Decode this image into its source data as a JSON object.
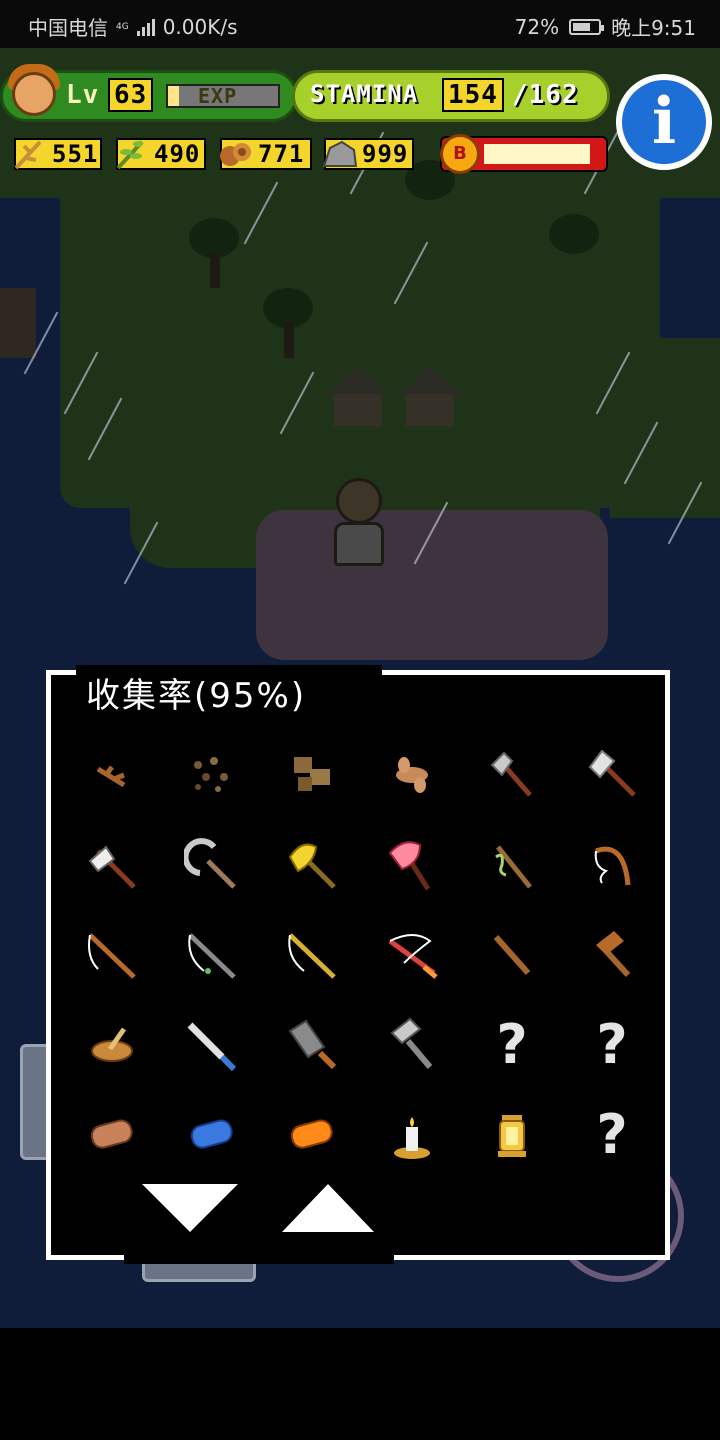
{
  "status_bar": {
    "carrier": "中国电信",
    "network": "4G",
    "speed": "0.00K/s",
    "battery": "72%",
    "battery_level": 0.72,
    "time": "晚上9:51"
  },
  "hud": {
    "level_label": "Lv",
    "level": "63",
    "exp_label": "EXP",
    "exp_fraction": 0.1,
    "stamina_label": "STAMINA",
    "stamina_current": "154",
    "stamina_max": "/162",
    "bonus_label": "B",
    "bonus_fraction": 0.95
  },
  "resources": [
    {
      "name": "branch",
      "value": "551"
    },
    {
      "name": "leaf",
      "value": "490"
    },
    {
      "name": "wood",
      "value": "771"
    },
    {
      "name": "stone",
      "value": "999"
    }
  ],
  "collection": {
    "title": "收集率(95%)",
    "items": [
      {
        "icon": "twig-icon",
        "unknown": false
      },
      {
        "icon": "pebbles-icon",
        "unknown": false
      },
      {
        "icon": "rocks-icon",
        "unknown": false
      },
      {
        "icon": "ginger-root-icon",
        "unknown": false
      },
      {
        "icon": "stone-axe-icon",
        "unknown": false
      },
      {
        "icon": "iron-axe-icon",
        "unknown": false
      },
      {
        "icon": "hand-axe-icon",
        "unknown": false
      },
      {
        "icon": "sickle-icon",
        "unknown": false
      },
      {
        "icon": "gold-battle-axe-icon",
        "unknown": false
      },
      {
        "icon": "red-battle-axe-icon",
        "unknown": false
      },
      {
        "icon": "vine-staff-icon",
        "unknown": false
      },
      {
        "icon": "wooden-bow-icon",
        "unknown": false
      },
      {
        "icon": "fishing-rod-icon",
        "unknown": false
      },
      {
        "icon": "fishing-rod-green-icon",
        "unknown": false
      },
      {
        "icon": "fishing-rod-gold-icon",
        "unknown": false
      },
      {
        "icon": "fishing-rod-red-icon",
        "unknown": false
      },
      {
        "icon": "wooden-stick-icon",
        "unknown": false
      },
      {
        "icon": "wooden-hammer-icon",
        "unknown": false
      },
      {
        "icon": "mortar-bowl-icon",
        "unknown": false
      },
      {
        "icon": "knife-icon",
        "unknown": false
      },
      {
        "icon": "cleaver-icon",
        "unknown": false
      },
      {
        "icon": "iron-hammer-icon",
        "unknown": false
      },
      {
        "icon": "question-mark",
        "unknown": true,
        "text": "?"
      },
      {
        "icon": "question-mark",
        "unknown": true,
        "text": "?"
      },
      {
        "icon": "log-icon",
        "unknown": false
      },
      {
        "icon": "blue-log-icon",
        "unknown": false
      },
      {
        "icon": "orange-log-icon",
        "unknown": false
      },
      {
        "icon": "candle-icon",
        "unknown": false
      },
      {
        "icon": "lantern-icon",
        "unknown": false
      },
      {
        "icon": "question-mark",
        "unknown": true,
        "text": "?"
      }
    ]
  },
  "colors": {
    "ocean": "#0f1d3a",
    "island": "#1f3319",
    "level_bar": "#2f8a1f",
    "stamina_bar": "#a8d02a",
    "number_badge": "#f3d52b",
    "info_button": "#1d6fd6",
    "bonus_bar": "#d31717"
  }
}
